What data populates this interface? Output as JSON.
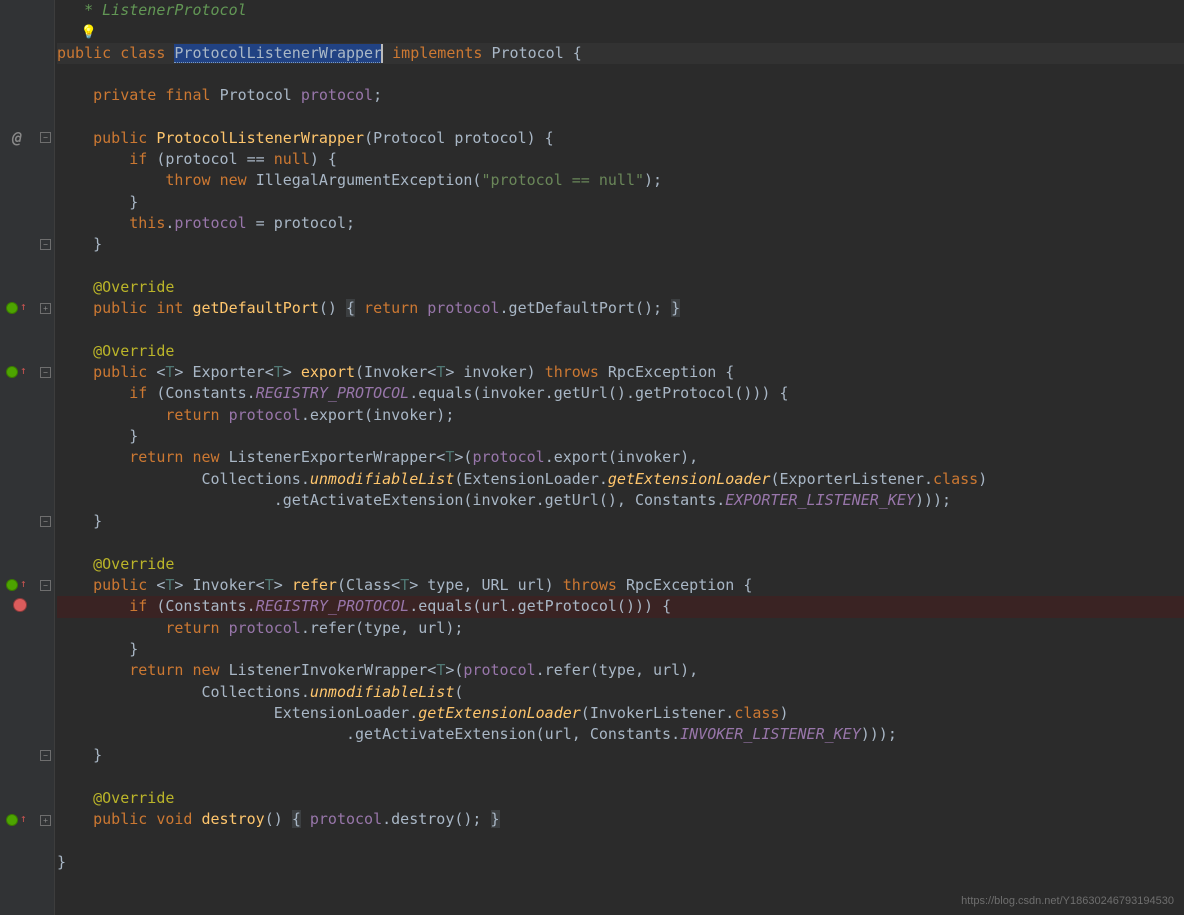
{
  "code": {
    "cmt_listener": "   * ListenerProtocol",
    "bulb": "   💡",
    "class_decl": {
      "public": "public ",
      "class_kw": "class ",
      "name": "ProtocolListenerWrapper",
      "implements": " implements ",
      "parent": "Protocol ",
      "brace": "{"
    },
    "field": {
      "private": "    private ",
      "final": "final ",
      "type": "Protocol ",
      "name": "protocol",
      "semi": ";"
    },
    "ctor": {
      "public": "    public ",
      "name": "ProtocolListenerWrapper",
      "params": "(Protocol protocol) {",
      "if": "        if ",
      "if_cond": "(protocol == ",
      "null": "null",
      "if_end": ") {",
      "throw": "            throw ",
      "new": "new ",
      "exc": "IllegalArgumentException(",
      "msg": "\"protocol == null\"",
      "exc_end": ");",
      "brace1": "        }",
      "this": "        this",
      "dot": ".",
      "assign_fld": "protocol",
      "eq": " = protocol;",
      "brace2": "    }"
    },
    "override": "    @Override",
    "getDefault": {
      "public": "    public ",
      "int": "int ",
      "name": "getDefaultPort",
      "paren": "() ",
      "brace_l": "{",
      "return": " return ",
      "proto": "protocol",
      "call": ".getDefaultPort(); ",
      "brace_r": "}"
    },
    "export": {
      "public": "    public ",
      "lt": "<",
      "t": "T",
      "gt": "> Exporter<",
      "t2": "T",
      "gt2": "> ",
      "name": "export",
      "params1": "(Invoker<",
      "t3": "T",
      "params2": "> invoker) ",
      "throws": "throws ",
      "exc": "RpcException {",
      "if": "        if ",
      "cond1": "(Constants.",
      "const": "REGISTRY_PROTOCOL",
      "cond2": ".equals(invoker.getUrl().getProtocol())) {",
      "return1": "            return ",
      "proto": "protocol",
      "call1": ".export(invoker);",
      "brace1": "        }",
      "return2": "        return ",
      "new": "new ",
      "wrapper": "ListenerExporterWrapper<",
      "t4": "T",
      "wrapper2": ">(",
      "proto2": "protocol",
      "call2": ".export(invoker),",
      "line2a": "                Collections.",
      "unmod": "unmodifiableList",
      "line2b": "(ExtensionLoader.",
      "getext": "getExtensionLoader",
      "line2c": "(ExporterListener.",
      "class": "class",
      "line2d": ")",
      "line3a": "                        .getActivateExtension(invoker.getUrl(), Constants.",
      "expkey": "EXPORTER_LISTENER_KEY",
      "line3b": ")));",
      "brace2": "    }"
    },
    "refer": {
      "public": "    public ",
      "lt": "<",
      "t": "T",
      "gt": "> Invoker<",
      "t2": "T",
      "gt2": "> ",
      "name": "refer",
      "params1": "(Class<",
      "t3": "T",
      "params2": "> type, URL url) ",
      "throws": "throws ",
      "exc": "RpcException {",
      "if": "        if ",
      "cond1": "(Constants.",
      "const": "REGISTRY_PROTOCOL",
      "cond2": ".equals(url.getProtocol())) {",
      "return1": "            return ",
      "proto": "protocol",
      "call1": ".refer(type, url);",
      "brace1": "        }",
      "return2": "        return ",
      "new": "new ",
      "wrapper": "ListenerInvokerWrapper<",
      "t4": "T",
      "wrapper2": ">(",
      "proto2": "protocol",
      "call2": ".refer(type, url),",
      "line2a": "                Collections.",
      "unmod": "unmodifiableList",
      "line2b": "(",
      "line3a": "                        ExtensionLoader.",
      "getext": "getExtensionLoader",
      "line3b": "(InvokerListener.",
      "class": "class",
      "line3c": ")",
      "line4a": "                                .getActivateExtension(url, Constants.",
      "invkey": "INVOKER_LISTENER_KEY",
      "line4b": ")));",
      "brace2": "    }"
    },
    "destroy": {
      "public": "    public ",
      "void": "void ",
      "name": "destroy",
      "paren": "() ",
      "brace_l": "{",
      "proto": " protocol",
      "call": ".destroy(); ",
      "brace_r": "}"
    },
    "close": "}"
  },
  "watermark": "https://blog.csdn.net/Y18630246793194530"
}
